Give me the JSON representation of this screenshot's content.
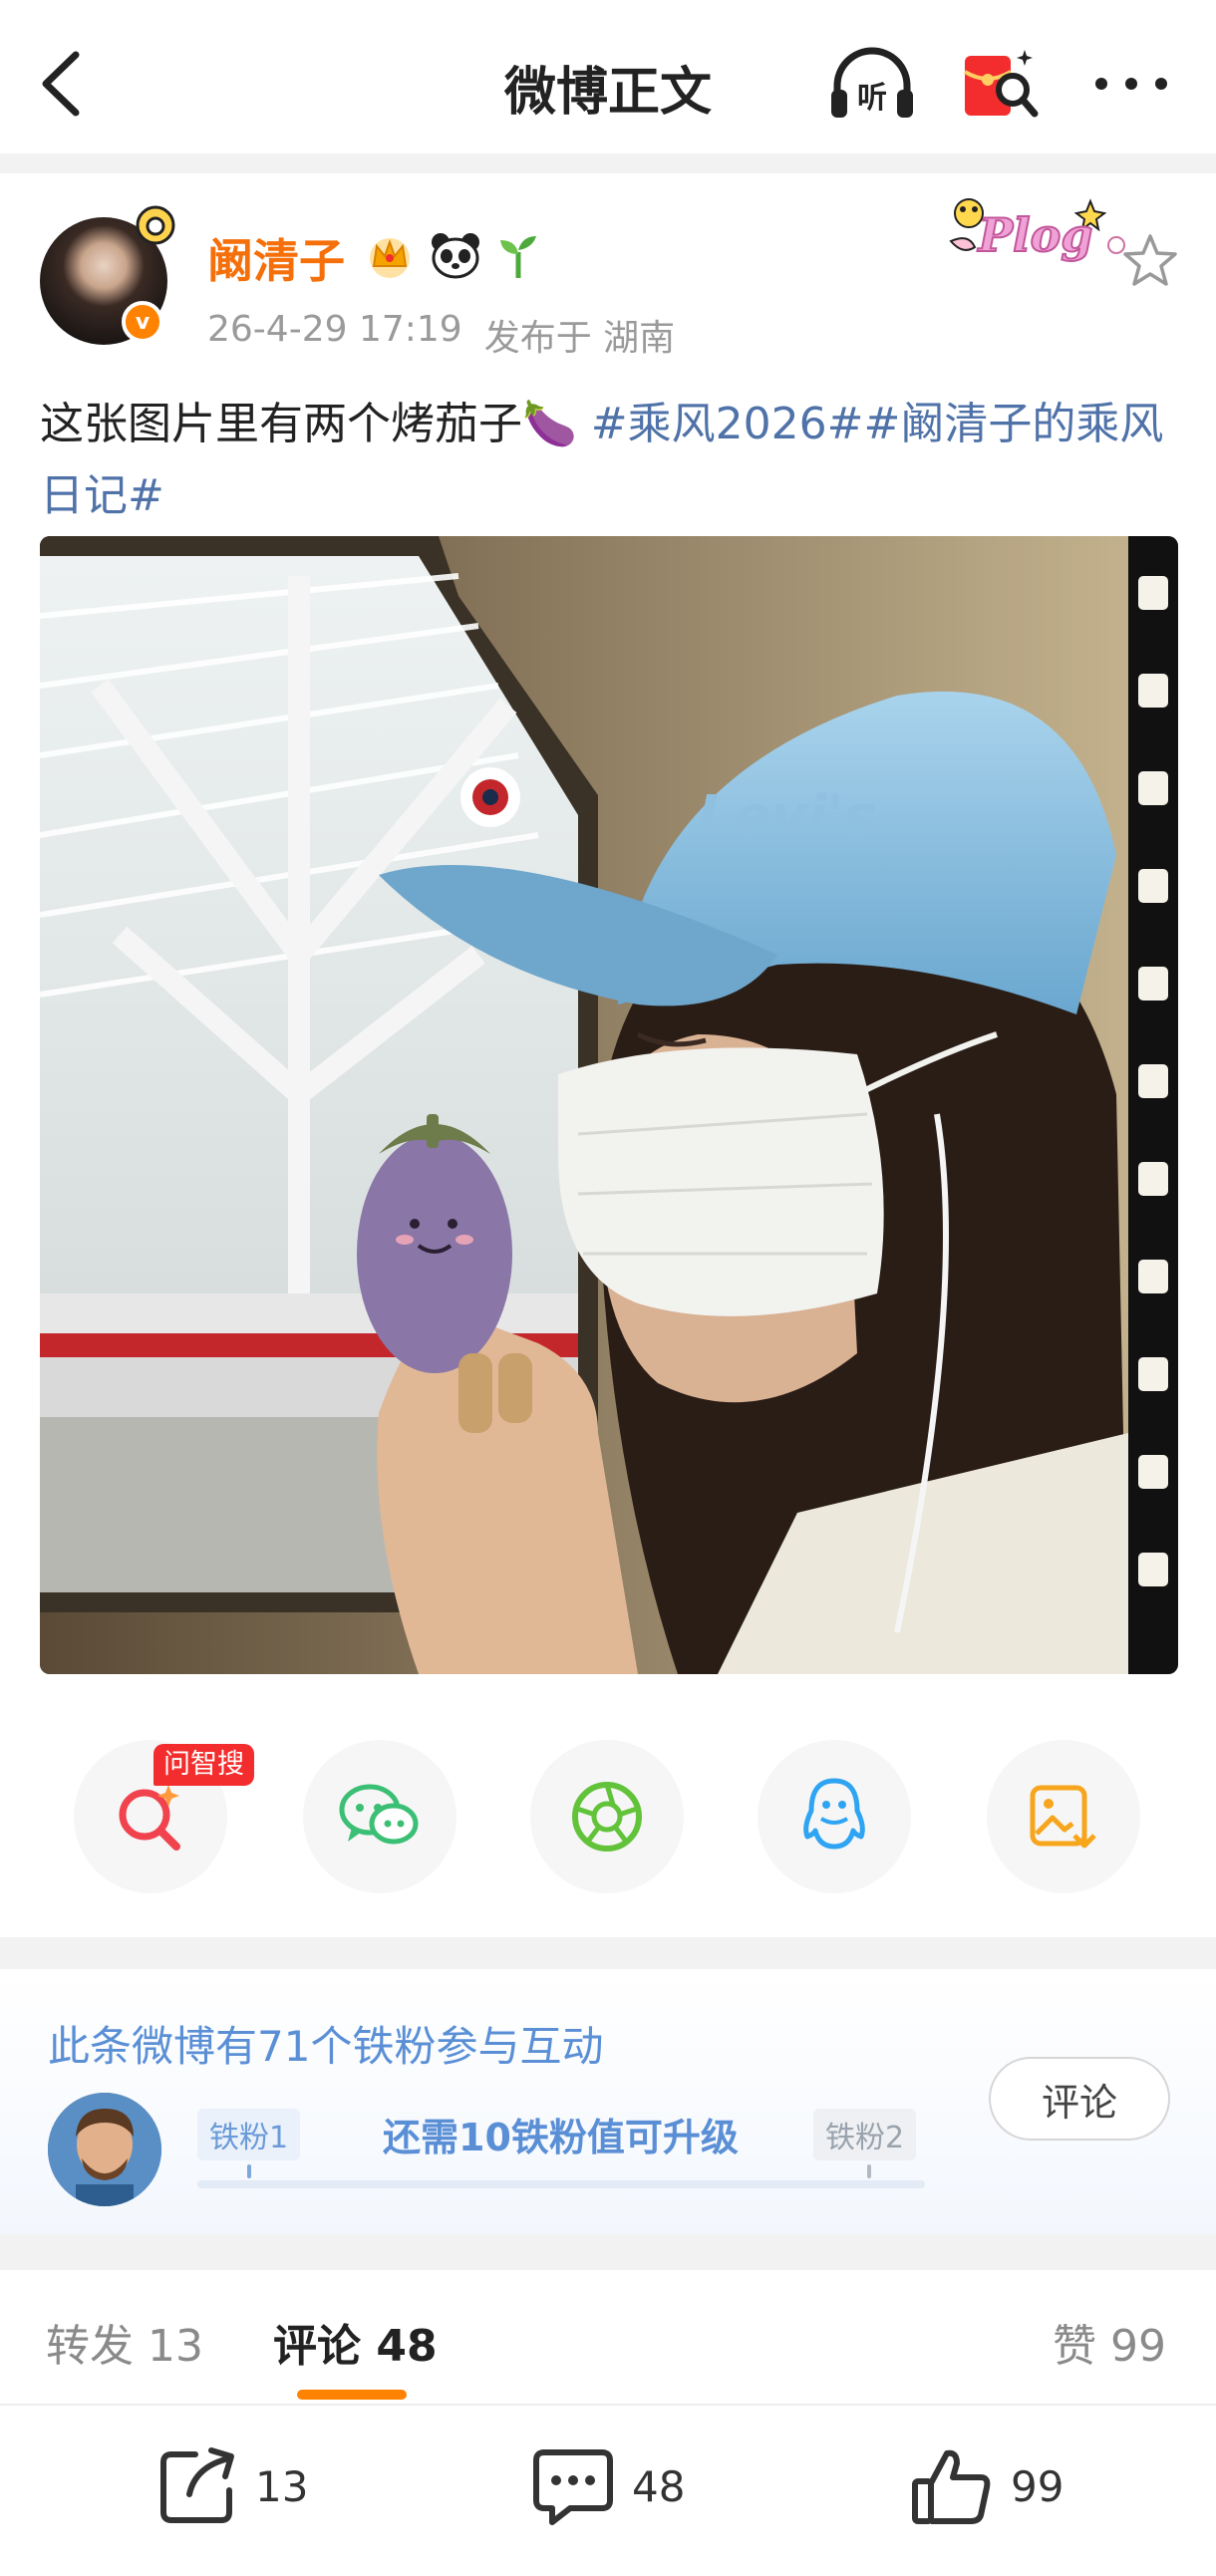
{
  "header": {
    "title": "微博正文",
    "listen_label": "听"
  },
  "post": {
    "username": "阚清子",
    "avatar_verified_mark": "v",
    "timestamp": "26-4-29 17:19",
    "location": "发布于 湖南",
    "sticker_text": "Plog",
    "text": "这张图片里有两个烤茄子",
    "emoji": "🍆",
    "topic1": "#乘风2026#",
    "topic2": "#阚清子的乘风日记#",
    "photo_cap_text": "Levi's"
  },
  "share": {
    "ask_tag": "问智搜"
  },
  "fans": {
    "title": "此条微博有71个铁粉参与互动",
    "level_current": "铁粉1",
    "level_next": "铁粉2",
    "upgrade_text": "还需10铁粉值可升级",
    "progress": 0.05,
    "comment_button": "评论"
  },
  "tabs": {
    "repost_label": "转发",
    "repost_count": "13",
    "comment_label": "评论",
    "comment_count": "48",
    "like_label": "赞",
    "like_count": "99"
  },
  "bottom": {
    "repost_count": "13",
    "comment_count": "48",
    "like_count": "99"
  },
  "colors": {
    "accent": "#ff8200",
    "username": "#f56f0a",
    "topic": "#4f72a8",
    "fan_blue": "#5a8fd6",
    "red_tag": "#f32d2d"
  }
}
